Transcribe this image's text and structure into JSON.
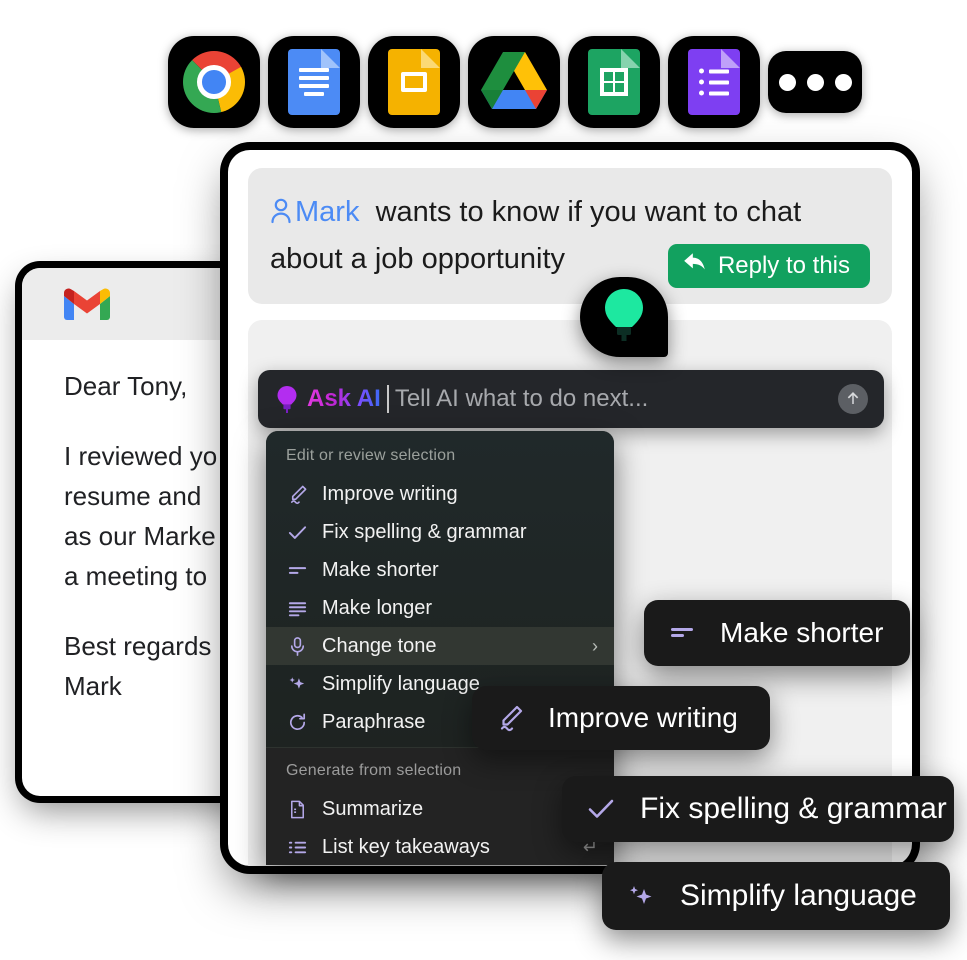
{
  "dock": {
    "items": [
      {
        "name": "chrome",
        "label": "Google Chrome"
      },
      {
        "name": "docs",
        "label": "Google Docs"
      },
      {
        "name": "slides",
        "label": "Google Slides"
      },
      {
        "name": "drive",
        "label": "Google Drive"
      },
      {
        "name": "sheets",
        "label": "Google Sheets"
      },
      {
        "name": "forms",
        "label": "Google Forms"
      },
      {
        "name": "more",
        "label": "More apps"
      }
    ]
  },
  "gmail": {
    "logo_label": "Gmail",
    "lines": [
      "Dear Tony,",
      "I reviewed yo",
      "resume and",
      "as our Marke",
      "a meeting to",
      "Best regards",
      "Mark"
    ]
  },
  "notification": {
    "sender": "Mark",
    "message": "wants to know if you want to chat about a job opportunity",
    "message_part1": "wants to know if you want to chat",
    "message_part2": "about a job opportunity",
    "reply_button": "Reply to this",
    "accent_green": "#12A15F",
    "sender_blue": "#4C8BF5"
  },
  "ask_ai": {
    "label": "Ask AI",
    "placeholder": "Tell AI what to do next...",
    "value": "",
    "send_icon": "arrow-up-icon",
    "bulb_icon": "bulb-icon"
  },
  "menu": {
    "section1": {
      "title": "Edit or review selection",
      "items": [
        {
          "label": "Improve writing",
          "icon": "pen-squiggle-icon",
          "active": false,
          "submenu": false
        },
        {
          "label": "Fix spelling & grammar",
          "icon": "check-icon",
          "active": false,
          "submenu": false
        },
        {
          "label": "Make shorter",
          "icon": "make-shorter-icon",
          "active": false,
          "submenu": false
        },
        {
          "label": "Make longer",
          "icon": "make-longer-icon",
          "active": false,
          "submenu": false
        },
        {
          "label": "Change tone",
          "icon": "microphone-icon",
          "active": true,
          "submenu": true
        },
        {
          "label": "Simplify language",
          "icon": "sparkles-icon",
          "active": false,
          "submenu": false
        },
        {
          "label": "Paraphrase",
          "icon": "refresh-icon",
          "active": false,
          "submenu": false
        }
      ]
    },
    "section2": {
      "title": "Generate from selection",
      "items": [
        {
          "label": "Summarize",
          "icon": "document-icon",
          "enter_hint": ""
        },
        {
          "label": "List key takeaways",
          "icon": "list-icon",
          "enter_hint": "↵"
        }
      ]
    },
    "chevron": "›"
  },
  "chips": [
    {
      "label": "Make shorter",
      "icon": "make-shorter-icon"
    },
    {
      "label": "Improve writing",
      "icon": "pen-squiggle-icon"
    },
    {
      "label": "Fix spelling & grammar",
      "icon": "check-icon"
    },
    {
      "label": "Simplify language",
      "icon": "sparkles-icon"
    }
  ],
  "badge": {
    "icon": "green-bulb-icon",
    "color": "#1DE8A0"
  },
  "colors": {
    "menu_bg": "#1F2320",
    "chip_bg": "#1A1A1A",
    "askai_bg": "#24262A",
    "icon_purple": "#B4A8E8",
    "panel_grey": "#F0F0F0",
    "notif_grey": "#E9E9E9"
  }
}
